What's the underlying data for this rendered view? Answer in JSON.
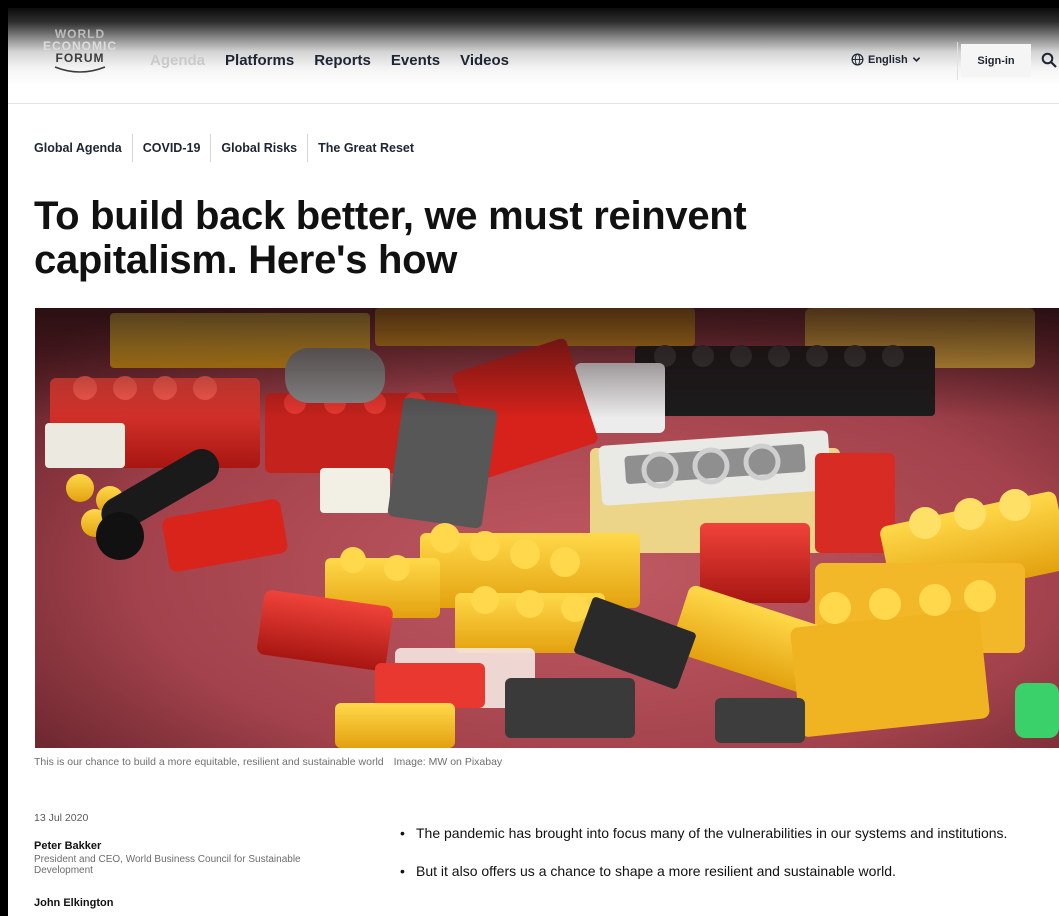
{
  "logo": {
    "line1": "WORLD",
    "line2": "ECONOMIC",
    "line3": "FORUM"
  },
  "nav": {
    "items": [
      {
        "label": "Agenda",
        "state": "faded"
      },
      {
        "label": "Platforms"
      },
      {
        "label": "Reports"
      },
      {
        "label": "Events"
      },
      {
        "label": "Videos"
      }
    ],
    "language": "English",
    "language_icon": "globe-icon",
    "language_chevron": "chevron-down-icon",
    "signin": "Sign-in",
    "search_icon": "search-icon"
  },
  "tags": [
    "Global Agenda",
    "COVID-19",
    "Global Risks",
    "The Great Reset"
  ],
  "article": {
    "title": "To build back better, we must reinvent capitalism. Here's how",
    "caption": "This is our chance to build a more equitable, resilient and sustainable world",
    "image_credit": "Image: MW on Pixabay",
    "date": "13 Jul 2020",
    "authors": [
      {
        "name": "Peter Bakker",
        "role": "President and CEO, World Business Council for Sustainable Development"
      },
      {
        "name": "John Elkington",
        "role": ""
      }
    ],
    "bullets": [
      "The pandemic has brought into focus many of the vulnerabilities in our systems and institutions.",
      "But it also offers us a chance to shape a more resilient and sustainable world."
    ]
  },
  "colors": {
    "nav_text": "#1d2433",
    "hero_background": "#a8454f",
    "brick_red": "#d62b25",
    "brick_yellow": "#f5c020"
  }
}
